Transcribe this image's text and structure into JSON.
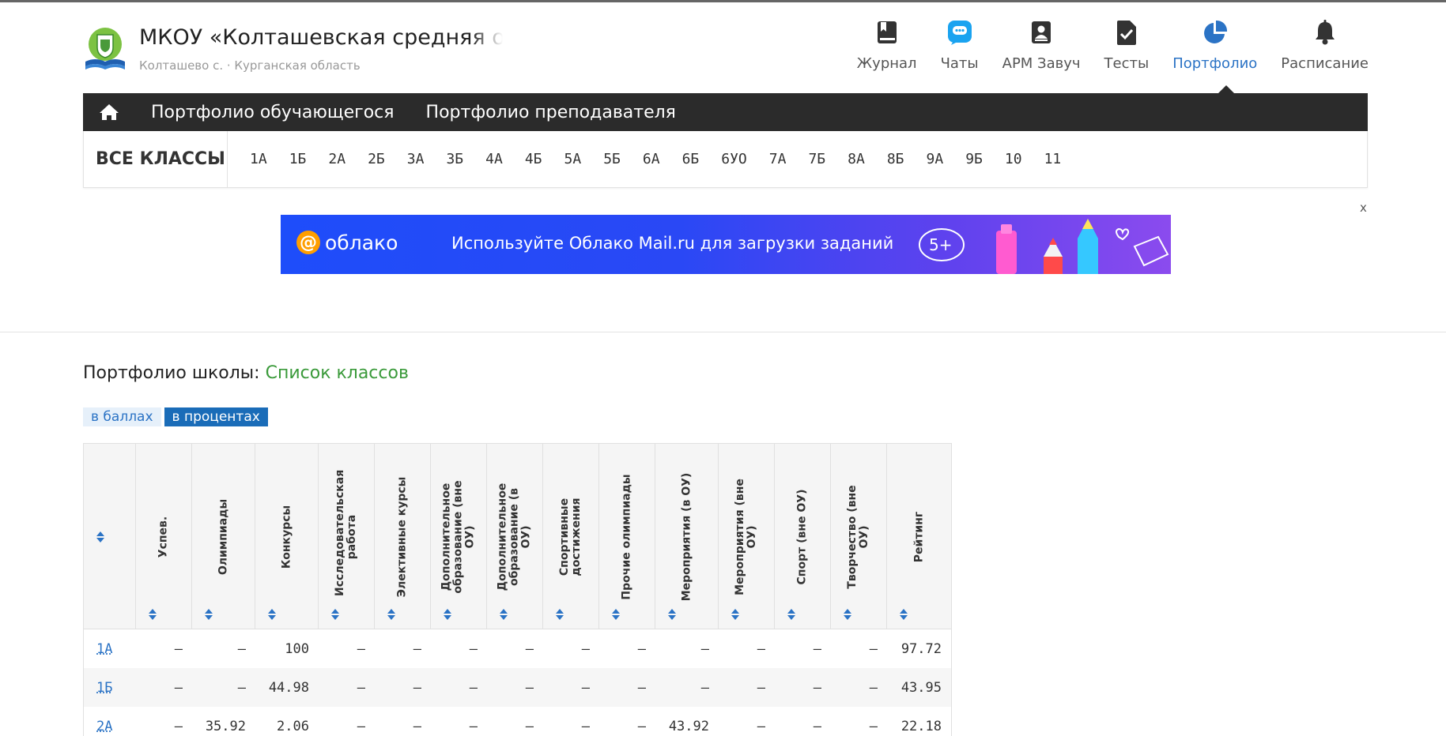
{
  "header": {
    "school_name": "МКОУ «Колташевская средняя об",
    "school_location": "Колташево с. · Курганская область"
  },
  "topnav": [
    {
      "label": "Журнал",
      "icon": "journal-icon"
    },
    {
      "label": "Чаты",
      "icon": "chat-icon"
    },
    {
      "label": "АРМ Завуч",
      "icon": "contact-book-icon"
    },
    {
      "label": "Тесты",
      "icon": "test-doc-icon"
    },
    {
      "label": "Портфолио",
      "icon": "pie-chart-icon",
      "active": true
    },
    {
      "label": "Расписание",
      "icon": "bell-icon"
    }
  ],
  "darkbar": {
    "home_icon": "home-icon",
    "links": [
      "Портфолио обучающегося",
      "Портфолио преподавателя"
    ]
  },
  "classbar": {
    "all_label": "ВСЕ КЛАССЫ",
    "classes": [
      "1А",
      "1Б",
      "2А",
      "2Б",
      "3А",
      "3Б",
      "4А",
      "4Б",
      "5А",
      "5Б",
      "6А",
      "6Б",
      "6УО",
      "7А",
      "7Б",
      "8А",
      "8Б",
      "9А",
      "9Б",
      "10",
      "11"
    ]
  },
  "banner": {
    "close": "x",
    "logo_text": "облако",
    "text": "Используйте Облако Mail.ru для загрузки заданий"
  },
  "page": {
    "title_prefix": "Портфолио школы:",
    "title_link": "Список классов",
    "toggle_points": "в баллах",
    "toggle_percent": "в процентах"
  },
  "table": {
    "columns": [
      "",
      "Успев.",
      "Олимпиады",
      "Конкурсы",
      "Исследовательская работа",
      "Элективные курсы",
      "Дополнительное образование (вне ОУ)",
      "Дополнительное образование (в ОУ)",
      "Спортивные достижения",
      "Прочие олимпиады",
      "Мероприятия (в ОУ)",
      "Мероприятия (вне ОУ)",
      "Спорт (вне ОУ)",
      "Творчество (вне ОУ)",
      "Рейтинг"
    ],
    "rows": [
      [
        "1А",
        "—",
        "—",
        "100",
        "—",
        "—",
        "—",
        "—",
        "—",
        "—",
        "—",
        "—",
        "—",
        "—",
        "97.72"
      ],
      [
        "1Б",
        "—",
        "—",
        "44.98",
        "—",
        "—",
        "—",
        "—",
        "—",
        "—",
        "—",
        "—",
        "—",
        "—",
        "43.95"
      ],
      [
        "2А",
        "—",
        "35.92",
        "2.06",
        "—",
        "—",
        "—",
        "—",
        "—",
        "—",
        "43.92",
        "—",
        "—",
        "—",
        "22.18"
      ]
    ]
  }
}
